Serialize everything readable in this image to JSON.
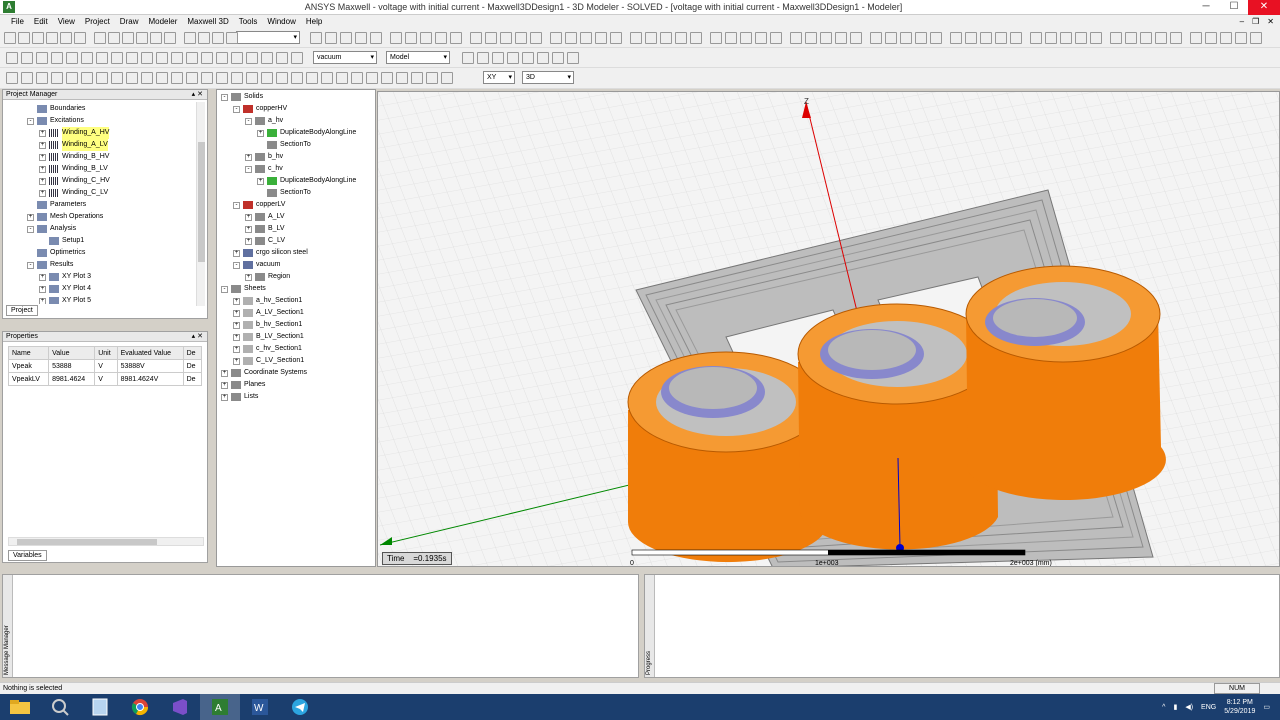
{
  "window": {
    "title": "ANSYS Maxwell - voltage with initial current - Maxwell3DDesign1 - 3D Modeler - SOLVED - [voltage with initial current - Maxwell3DDesign1 - Modeler]",
    "app_icon": "ansys-logo-icon"
  },
  "menu": [
    "File",
    "Edit",
    "View",
    "Project",
    "Draw",
    "Modeler",
    "Maxwell 3D",
    "Tools",
    "Window",
    "Help"
  ],
  "toolbar": {
    "material_combo": "vacuum",
    "model_combo": "Model",
    "plane_combo": "XY",
    "view_combo": "3D"
  },
  "project_manager": {
    "title": "Project Manager",
    "tab": "Project",
    "items": [
      {
        "label": "Boundaries",
        "level": 2,
        "exp": ""
      },
      {
        "label": "Excitations",
        "level": 2,
        "exp": "-"
      },
      {
        "label": "Winding_A_HV",
        "level": 3,
        "exp": "+",
        "hl": true
      },
      {
        "label": "Winding_A_LV",
        "level": 3,
        "exp": "+",
        "hl": true
      },
      {
        "label": "Winding_B_HV",
        "level": 3,
        "exp": "+"
      },
      {
        "label": "Winding_B_LV",
        "level": 3,
        "exp": "+"
      },
      {
        "label": "Winding_C_HV",
        "level": 3,
        "exp": "+"
      },
      {
        "label": "Winding_C_LV",
        "level": 3,
        "exp": "+"
      },
      {
        "label": "Parameters",
        "level": 2,
        "exp": ""
      },
      {
        "label": "Mesh Operations",
        "level": 2,
        "exp": "+"
      },
      {
        "label": "Analysis",
        "level": 2,
        "exp": "-"
      },
      {
        "label": "Setup1",
        "level": 3,
        "exp": ""
      },
      {
        "label": "Optimetrics",
        "level": 2,
        "exp": ""
      },
      {
        "label": "Results",
        "level": 2,
        "exp": "-"
      },
      {
        "label": "XY Plot 3",
        "level": 3,
        "exp": "+"
      },
      {
        "label": "XY Plot 4",
        "level": 3,
        "exp": "+"
      },
      {
        "label": "XY Plot 5",
        "level": 3,
        "exp": "+"
      }
    ]
  },
  "properties": {
    "title": "Properties",
    "tab": "Variables",
    "columns": [
      "Name",
      "Value",
      "Unit",
      "Evaluated Value",
      "De"
    ],
    "rows": [
      [
        "Vpeak",
        "53888",
        "V",
        "53888V",
        "De"
      ],
      [
        "VpeakLV",
        "8981.4624",
        "V",
        "8981.4624V",
        "De"
      ]
    ]
  },
  "model_tree": [
    {
      "label": "Solids",
      "level": 0,
      "exp": "-"
    },
    {
      "label": "copperHV",
      "level": 1,
      "exp": "-"
    },
    {
      "label": "a_hv",
      "level": 2,
      "exp": "-"
    },
    {
      "label": "DuplicateBodyAlongLine",
      "level": 3,
      "exp": "+"
    },
    {
      "label": "SectionTo",
      "level": 3,
      "exp": ""
    },
    {
      "label": "b_hv",
      "level": 2,
      "exp": "+"
    },
    {
      "label": "c_hv",
      "level": 2,
      "exp": "-"
    },
    {
      "label": "DuplicateBodyAlongLine",
      "level": 3,
      "exp": "+"
    },
    {
      "label": "SectionTo",
      "level": 3,
      "exp": ""
    },
    {
      "label": "copperLV",
      "level": 1,
      "exp": "-"
    },
    {
      "label": "A_LV",
      "level": 2,
      "exp": "+"
    },
    {
      "label": "B_LV",
      "level": 2,
      "exp": "+"
    },
    {
      "label": "C_LV",
      "level": 2,
      "exp": "+"
    },
    {
      "label": "crgo silicon steel",
      "level": 1,
      "exp": "+"
    },
    {
      "label": "vacuum",
      "level": 1,
      "exp": "-"
    },
    {
      "label": "Region",
      "level": 2,
      "exp": "+"
    },
    {
      "label": "Sheets",
      "level": 0,
      "exp": "-"
    },
    {
      "label": "a_hv_Section1",
      "level": 1,
      "exp": "+"
    },
    {
      "label": "A_LV_Section1",
      "level": 1,
      "exp": "+"
    },
    {
      "label": "b_hv_Section1",
      "level": 1,
      "exp": "+"
    },
    {
      "label": "B_LV_Section1",
      "level": 1,
      "exp": "+"
    },
    {
      "label": "c_hv_Section1",
      "level": 1,
      "exp": "+"
    },
    {
      "label": "C_LV_Section1",
      "level": 1,
      "exp": "+"
    },
    {
      "label": "Coordinate Systems",
      "level": 0,
      "exp": "+"
    },
    {
      "label": "Planes",
      "level": 0,
      "exp": "+"
    },
    {
      "label": "Lists",
      "level": 0,
      "exp": "+"
    }
  ],
  "viewport": {
    "time_label": "Time",
    "time_value": "=0.1935s",
    "axis_z": "Z",
    "scale_0": "0",
    "scale_1": "1e+003",
    "scale_2": "2e+003 (mm)",
    "coil_color": "#f07d0a",
    "core_color": "#b8b8b8"
  },
  "message_manager": "Message Manager",
  "progress": "Progress",
  "status": {
    "text": "Nothing is selected",
    "num": "NUM"
  },
  "taskbar": {
    "apps": [
      "file-explorer-icon",
      "search-icon",
      "notepad-icon",
      "chrome-icon",
      "visual-studio-icon",
      "ansys-icon",
      "word-icon",
      "telegram-icon"
    ],
    "lang": "ENG",
    "time": "8:12 PM",
    "date": "5/29/2019"
  }
}
